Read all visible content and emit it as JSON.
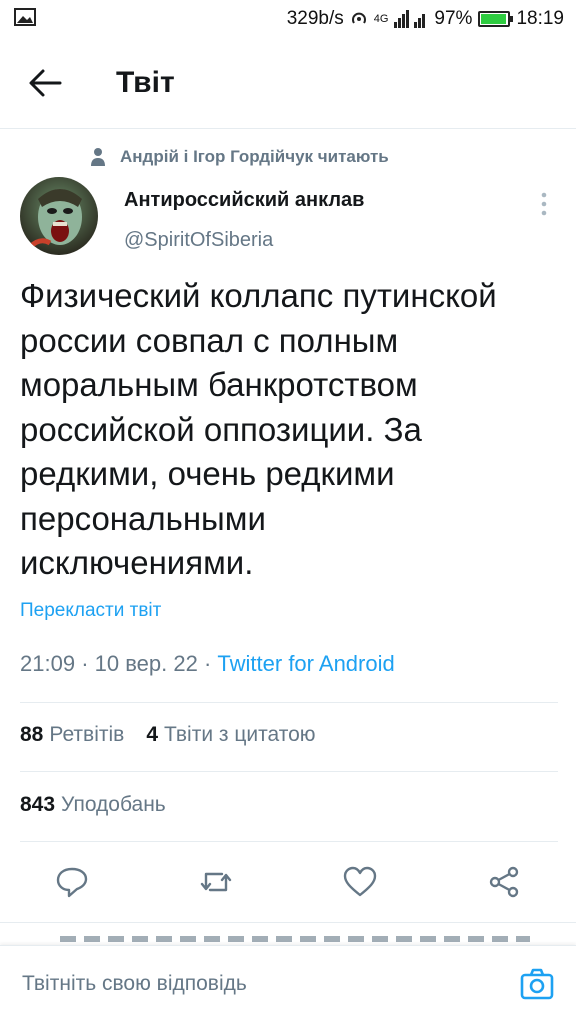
{
  "status_bar": {
    "speed": "329b/s",
    "network": "4G",
    "battery_percent": "97%",
    "battery_level": 0.97,
    "time": "18:19"
  },
  "header": {
    "title": "Твіт"
  },
  "social_context": "Андрій і Ігор Гордійчук читають",
  "author": {
    "name": "Антироссийский анклав",
    "handle": "@SpiritOfSiberia"
  },
  "tweet": {
    "text_lines": [
      "Физический коллапс путинской",
      "россии совпал с полным",
      "моральным банкротством",
      "российской оппозиции. За",
      "редкими, очень редкими",
      "персональными",
      "исключениями."
    ],
    "translate_label": "Перекласти твіт",
    "time": "21:09",
    "date": "10 вер. 22",
    "source": "Twitter for Android"
  },
  "stats": {
    "retweets_count": "88",
    "retweets_label": "Ретвітів",
    "quotes_count": "4",
    "quotes_label": "Твіти з цитатою",
    "likes_count": "843",
    "likes_label": "Уподобань"
  },
  "actions": {
    "icons": [
      "reply-icon",
      "retweet-icon",
      "like-icon",
      "share-icon"
    ]
  },
  "reply": {
    "placeholder": "Твітніть свою відповідь"
  },
  "colors": {
    "accent": "#1da1f2",
    "secondary_text": "#657786",
    "primary_text": "#14171a",
    "divider": "#e6ecf0"
  }
}
